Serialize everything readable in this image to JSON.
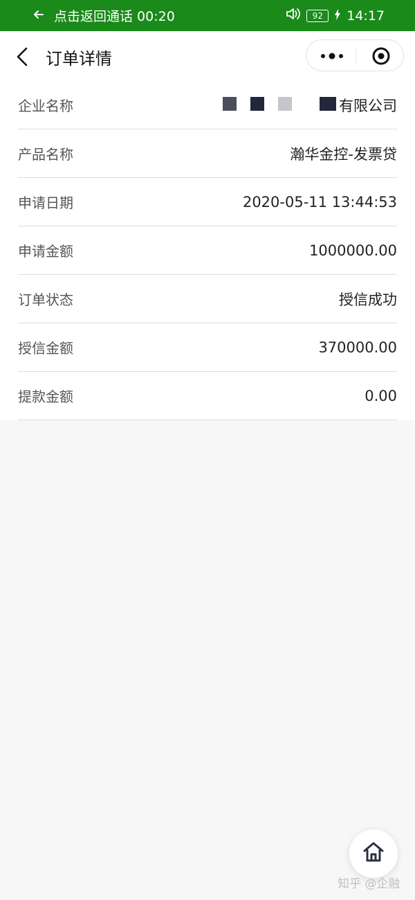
{
  "statusbar": {
    "call_text": "点击返回通话 00:20",
    "battery": "92",
    "time": "14:17",
    "icons": [
      "arrow-left-icon",
      "speaker-icon",
      "battery-icon",
      "charging-icon"
    ]
  },
  "navbar": {
    "title": "订单详情",
    "icons": [
      "chevron-left-icon",
      "more-dots-icon",
      "target-icon"
    ]
  },
  "details": [
    {
      "label": "企业名称",
      "value": "有限公司",
      "redacted": true
    },
    {
      "label": "产品名称",
      "value": "瀚华金控-发票贷"
    },
    {
      "label": "申请日期",
      "value": "2020-05-11 13:44:53"
    },
    {
      "label": "申请金额",
      "value": "1000000.00"
    },
    {
      "label": "订单状态",
      "value": "授信成功"
    },
    {
      "label": "授信金额",
      "value": "370000.00"
    },
    {
      "label": "提款金额",
      "value": "0.00"
    }
  ],
  "home_button": {
    "icon": "home-icon"
  },
  "watermark": "知乎 @企融",
  "colors": {
    "statusbar_bg": "#1a8a1a",
    "page_bg": "#f7f7f7",
    "card_bg": "#ffffff"
  }
}
